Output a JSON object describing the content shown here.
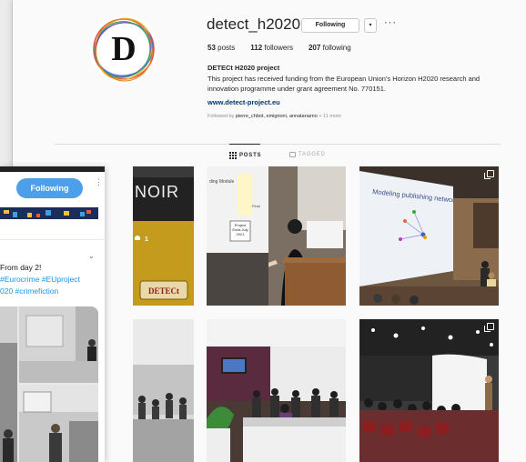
{
  "profile": {
    "username": "detect_h2020",
    "follow_button": "Following",
    "dropdown_glyph": "▾",
    "more_glyph": "···",
    "avatar_letter": "D",
    "posts_count": "53",
    "posts_label": "posts",
    "followers_count": "112",
    "followers_label": "followers",
    "following_count": "207",
    "following_label": "following",
    "full_name": "DETECt H2020 project",
    "bio": "This project has received funding from the European Union's Horizon H2020 research and innovation programme under grant agreement No. 770151.",
    "website": "www.detect-project.eu",
    "followed_by_prefix": "Followed by",
    "followed_by_names": "pierre_chbot, emigrioni, annatanarno",
    "followed_by_more": "+ 11 more"
  },
  "tabs": {
    "posts": "POSTS",
    "tagged": "TAGGED"
  },
  "posts": {
    "p1_text": "NOIR",
    "p1_logo": "DETECt",
    "p1_count": "1",
    "p2_slide_label": "Project Ends July 2021",
    "p2_slide_top": "ding Module",
    "p2_slide_side": "Final",
    "p3_slide_title": "Modeling publishing networks"
  },
  "twitter": {
    "follow_button": "Following",
    "more_glyph": "⋮",
    "chevron": "⌄",
    "tweet_line1": "From day 2!",
    "tweet_line2": "#Eurocrime #EUproject",
    "tweet_line3": "020 #crimefiction"
  },
  "colors": {
    "ig_link": "#00376b",
    "twitter_blue": "#4d9fe9",
    "hashtag_blue": "#1b95e0"
  }
}
